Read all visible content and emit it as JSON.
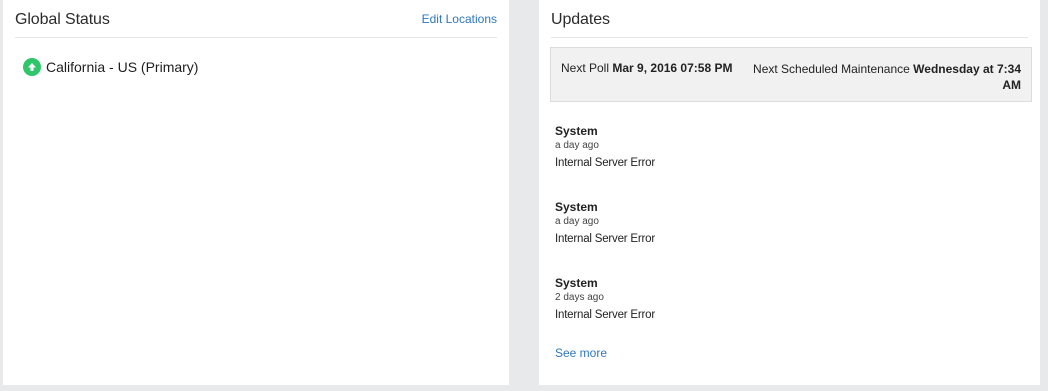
{
  "global_status": {
    "title": "Global Status",
    "edit_link": "Edit Locations",
    "locations": [
      {
        "label": "California - US (Primary)",
        "status_icon": "up-arrow-icon",
        "status_color": "#2ec56b"
      }
    ]
  },
  "updates": {
    "title": "Updates",
    "poll": {
      "next_poll_label": "Next Poll",
      "next_poll_value": "Mar 9, 2016 07:58 PM",
      "maintenance_label": "Next Scheduled Maintenance",
      "maintenance_value": "Wednesday at 7:34 AM"
    },
    "items": [
      {
        "source": "System",
        "time": "a day ago",
        "message": "Internal Server Error"
      },
      {
        "source": "System",
        "time": "a day ago",
        "message": "Internal Server Error"
      },
      {
        "source": "System",
        "time": "2 days ago",
        "message": "Internal Server Error"
      }
    ],
    "see_more": "See more"
  },
  "colors": {
    "link": "#2f77c0",
    "status_up": "#2ec56b",
    "background": "#e8e9ea"
  }
}
